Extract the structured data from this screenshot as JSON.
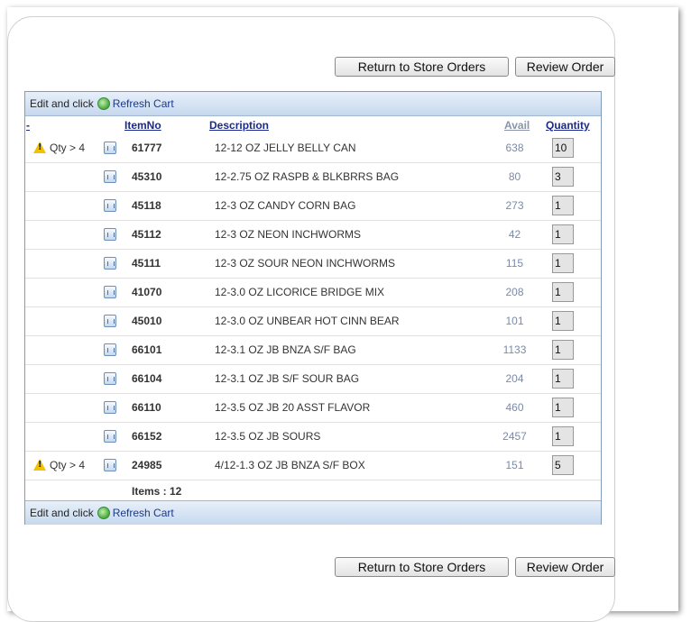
{
  "buttons": {
    "return_label": "Return to Store Orders",
    "review_label": "Review Order"
  },
  "toolbar": {
    "edit_text": "Edit and click",
    "refresh_label": "Refresh Cart"
  },
  "columns": {
    "dash": "-",
    "itemno": "ItemNo",
    "description": "Description",
    "avail": "Avail",
    "quantity": "Quantity"
  },
  "rows": [
    {
      "warning": "Qty > 4",
      "itemno": "61777",
      "description": "12-12 OZ JELLY BELLY CAN",
      "avail": "638",
      "qty": "10"
    },
    {
      "warning": "",
      "itemno": "45310",
      "description": "12-2.75 OZ RASPB & BLKBRRS BAG",
      "avail": "80",
      "qty": "3"
    },
    {
      "warning": "",
      "itemno": "45118",
      "description": "12-3 OZ CANDY CORN BAG",
      "avail": "273",
      "qty": "1"
    },
    {
      "warning": "",
      "itemno": "45112",
      "description": "12-3 OZ NEON INCHWORMS",
      "avail": "42",
      "qty": "1"
    },
    {
      "warning": "",
      "itemno": "45111",
      "description": "12-3 OZ SOUR NEON INCHWORMS",
      "avail": "115",
      "qty": "1"
    },
    {
      "warning": "",
      "itemno": "41070",
      "description": "12-3.0 OZ LICORICE BRIDGE MIX",
      "avail": "208",
      "qty": "1"
    },
    {
      "warning": "",
      "itemno": "45010",
      "description": "12-3.0 OZ UNBEAR HOT CINN BEAR",
      "avail": "101",
      "qty": "1"
    },
    {
      "warning": "",
      "itemno": "66101",
      "description": "12-3.1 OZ JB BNZA S/F BAG",
      "avail": "1133",
      "qty": "1"
    },
    {
      "warning": "",
      "itemno": "66104",
      "description": "12-3.1 OZ JB S/F SOUR BAG",
      "avail": "204",
      "qty": "1"
    },
    {
      "warning": "",
      "itemno": "66110",
      "description": "12-3.5 OZ JB 20 ASST FLAVOR",
      "avail": "460",
      "qty": "1"
    },
    {
      "warning": "",
      "itemno": "66152",
      "description": "12-3.5 OZ JB SOURS",
      "avail": "2457",
      "qty": "1"
    },
    {
      "warning": "Qty > 4",
      "itemno": "24985",
      "description": "4/12-1.3 OZ JB BNZA S/F BOX",
      "avail": "151",
      "qty": "5"
    }
  ],
  "footer": {
    "items_total": "Items : 12"
  }
}
